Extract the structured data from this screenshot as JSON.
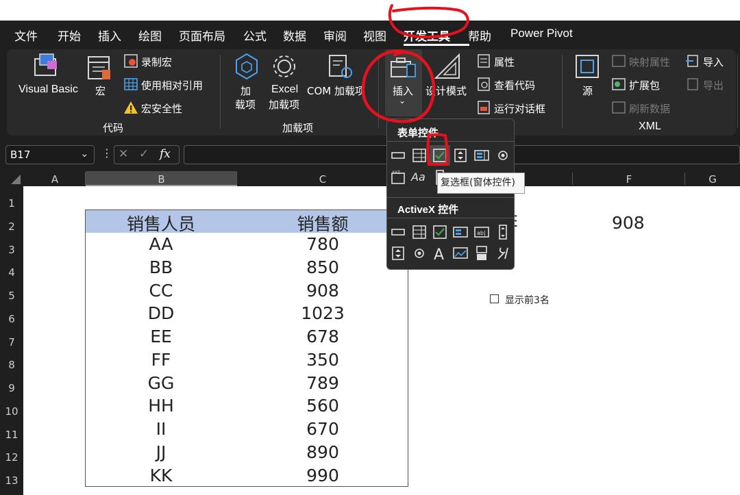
{
  "menu": {
    "items": [
      "文件",
      "开始",
      "插入",
      "绘图",
      "页面布局",
      "公式",
      "数据",
      "审阅",
      "视图",
      "开发工具",
      "帮助",
      "Power Pivot"
    ],
    "active": "开发工具"
  },
  "ribbon": {
    "code": {
      "visual_basic": "Visual Basic",
      "macro": "宏",
      "record_macro": "录制宏",
      "relative_ref": "使用相对引用",
      "macro_security": "宏安全性",
      "group_label": "代码"
    },
    "addins": {
      "addin_line1": "加",
      "addin_line2": "载项",
      "excel_line1": "Excel",
      "excel_line2": "加载项",
      "com": "COM 加载项",
      "group_label": "加载项"
    },
    "controls": {
      "insert": "插入",
      "design_mode": "设计模式",
      "properties": "属性",
      "view_code": "查看代码",
      "run_dialog": "运行对话框"
    },
    "xml": {
      "source": "源",
      "map_properties": "映射属性",
      "expansion_pack": "扩展包",
      "refresh_data": "刷新数据",
      "import": "导入",
      "export": "导出",
      "group_label": "XML"
    }
  },
  "formula_bar": {
    "name_box": "B17",
    "fx": "fx",
    "value": ""
  },
  "columns": [
    "A",
    "B",
    "C",
    "F",
    "G"
  ],
  "rows": [
    "1",
    "2",
    "3",
    "4",
    "5",
    "6",
    "7",
    "8",
    "9",
    "10",
    "11",
    "12",
    "13"
  ],
  "table": {
    "headers": [
      "销售人员",
      "销售额"
    ],
    "rows": [
      [
        "AA",
        "780"
      ],
      [
        "BB",
        "850"
      ],
      [
        "CC",
        "908"
      ],
      [
        "DD",
        "1023"
      ],
      [
        "EE",
        "678"
      ],
      [
        "FF",
        "350"
      ],
      [
        "GG",
        "789"
      ],
      [
        "HH",
        "560"
      ],
      [
        "II",
        "670"
      ],
      [
        "JJ",
        "890"
      ],
      [
        "KK",
        "990"
      ]
    ]
  },
  "cells": {
    "e2_partial": "E",
    "f2": "908"
  },
  "checkbox": {
    "label": "显示前3名"
  },
  "dropdown": {
    "form_controls_title": "表单控件",
    "activex_title": "ActiveX 控件",
    "tooltip": "复选框(窗体控件)",
    "aa_label": "Aa"
  },
  "colors": {
    "menu_bg": "#1f1f1f",
    "ribbon_bg": "#2a2a2a",
    "header_fill": "#b4c6e7",
    "annotation_red": "#e3121c",
    "checkbox_green": "#3ea84a"
  }
}
